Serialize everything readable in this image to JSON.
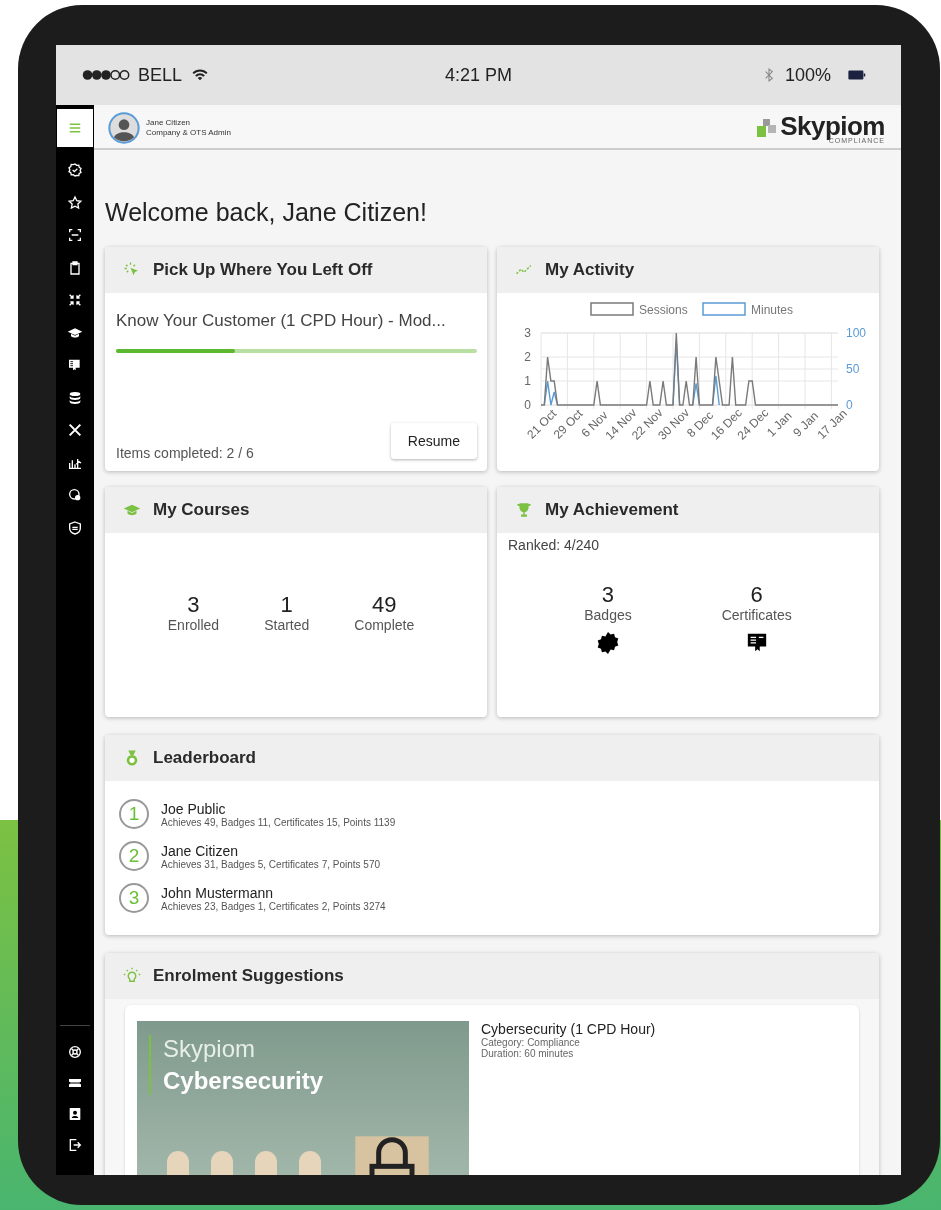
{
  "status_bar": {
    "carrier": "BELL",
    "time": "4:21 PM",
    "battery": "100%"
  },
  "header": {
    "user_name": "Jane Citizen",
    "user_role": "Company & OTS Admin",
    "logo_text": "Skypiom",
    "logo_subtext": "COMPLIANCE"
  },
  "welcome": "Welcome back, Jane Citizen!",
  "resume_card": {
    "title": "Pick Up Where You Left Off",
    "course": "Know Your Customer (1 CPD Hour) - Mod...",
    "level": 0.33,
    "items_completed": "Items completed: 2 / 6",
    "button": "Resume"
  },
  "activity_card": {
    "title": "My Activity",
    "chart_data": {
      "type": "line",
      "categories": [
        "21 Oct",
        null,
        null,
        null,
        null,
        null,
        null,
        null,
        "29 Oct",
        null,
        null,
        null,
        null,
        null,
        null,
        null,
        "6 Nov",
        null,
        null,
        null,
        null,
        null,
        null,
        null,
        "14 Nov",
        null,
        null,
        null,
        null,
        null,
        null,
        null,
        "22 Nov",
        null,
        null,
        null,
        null,
        null,
        null,
        null,
        "30 Nov",
        null,
        null,
        null,
        null,
        null,
        null,
        null,
        "8 Dec",
        null,
        null,
        null,
        null,
        null,
        null,
        null,
        "16 Dec",
        null,
        null,
        null,
        null,
        null,
        null,
        null,
        "24 Dec",
        null,
        null,
        null,
        null,
        null,
        null,
        null,
        "1 Jan",
        null,
        null,
        null,
        null,
        null,
        null,
        null,
        "9 Jan",
        null,
        null,
        null,
        null,
        null,
        null,
        null,
        "17 Jan",
        null,
        null
      ],
      "grid": true,
      "legend": "top",
      "ylim": [
        0,
        3
      ],
      "yticks": [
        0,
        1,
        2,
        3
      ],
      "y2lim": [
        0,
        100
      ],
      "y2ticks": [
        0,
        50,
        100
      ],
      "series": [
        {
          "name": "Sessions",
          "color": "#7a7a7a",
          "values": [
            0,
            0,
            2,
            1,
            1,
            0,
            0,
            0,
            0,
            0,
            0,
            0,
            0,
            0,
            0,
            0,
            0,
            1,
            0,
            0,
            0,
            0,
            0,
            0,
            0,
            0,
            0,
            0,
            0,
            0,
            0,
            0,
            0,
            1,
            0,
            0,
            0,
            1,
            0,
            0,
            0,
            3,
            0,
            0,
            1,
            0,
            0,
            2,
            0,
            0,
            0,
            0,
            0,
            2,
            1,
            0,
            0,
            0,
            2,
            0,
            0,
            0,
            0,
            1,
            1,
            0,
            0,
            0,
            0,
            0,
            0,
            0,
            0,
            0,
            0,
            0,
            0,
            0,
            0,
            0,
            0,
            0,
            0,
            0,
            0,
            0,
            0,
            0,
            0,
            0,
            0
          ]
        },
        {
          "name": "Minutes",
          "color": "#5b9bd5",
          "axis": "y2",
          "values": [
            null,
            0,
            33,
            0,
            18,
            0,
            null,
            null,
            null,
            null,
            null,
            null,
            null,
            null,
            null,
            null,
            null,
            null,
            null,
            null,
            null,
            null,
            null,
            null,
            null,
            null,
            null,
            null,
            null,
            null,
            null,
            null,
            null,
            null,
            null,
            null,
            null,
            null,
            null,
            null,
            0,
            88,
            0,
            null,
            null,
            null,
            0,
            30,
            0,
            null,
            null,
            null,
            0,
            40,
            0,
            null,
            null,
            null,
            null,
            null,
            null,
            null,
            null,
            null,
            null,
            null,
            null,
            null,
            null,
            null,
            null,
            null,
            null,
            null,
            null,
            null,
            null,
            null,
            null,
            null,
            null,
            null,
            null,
            null,
            null,
            null,
            null,
            null,
            null,
            null,
            null
          ]
        }
      ]
    }
  },
  "courses_card": {
    "title": "My Courses",
    "stats": [
      {
        "value": "3",
        "label": "Enrolled"
      },
      {
        "value": "1",
        "label": "Started"
      },
      {
        "value": "49",
        "label": "Complete"
      }
    ]
  },
  "achievement_card": {
    "title": "My Achievement",
    "ranked": "Ranked: 4/240",
    "stats": [
      {
        "kind": "badge",
        "value": "3",
        "label": "Badges"
      },
      {
        "kind": "certificate",
        "value": "6",
        "label": "Certificates"
      }
    ]
  },
  "leaderboard": {
    "title": "Leaderboard",
    "rows": [
      {
        "rank": "1",
        "name": "Joe Public",
        "details": "Achieves 49, Badges 11, Certificates 15, Points 1139"
      },
      {
        "rank": "2",
        "name": "Jane Citizen",
        "details": "Achieves 31, Badges 5, Certificates 7, Points 570"
      },
      {
        "rank": "3",
        "name": "John Mustermann",
        "details": "Achieves 23, Badges 1, Certificates 2, Points 3274"
      }
    ]
  },
  "enrolment": {
    "title": "Enrolment Suggestions",
    "items": [
      {
        "banner_brand": "Skypiom",
        "banner_title": "Cybersecurity",
        "title": "Cybersecurity (1 CPD Hour)",
        "category": "Category: Compliance",
        "duration": "Duration: 60 minutes"
      }
    ]
  }
}
